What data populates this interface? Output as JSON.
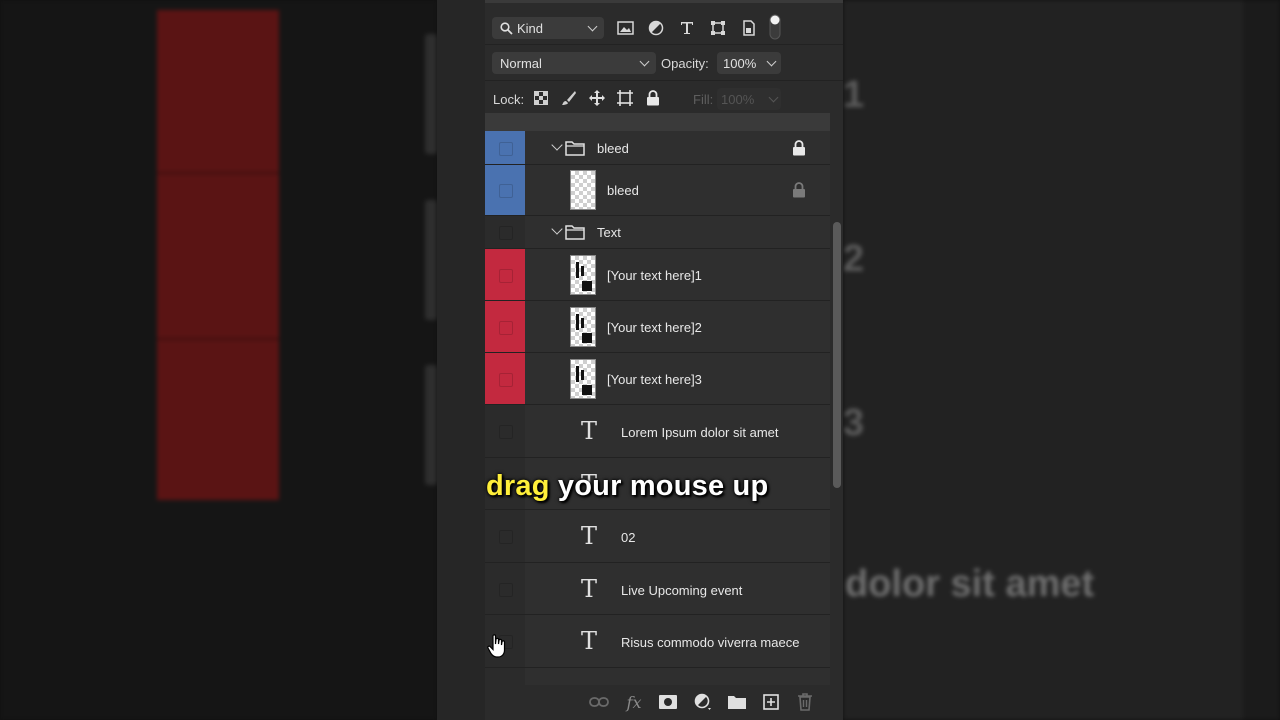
{
  "colors": {
    "panel_bg": "#2b2b2b",
    "row_bg": "#2f2f2f",
    "label_blue": "#4a72b0",
    "label_red": "#c3293f",
    "caption_highlight": "#ffef3a",
    "caption_text": "#ffffff"
  },
  "background": {
    "num1": "1",
    "num2": "2",
    "num3": "3",
    "text": "dolor sit amet"
  },
  "filter": {
    "kind_label": "Kind",
    "icons": [
      "image-filter-icon",
      "adjustment-filter-icon",
      "type-filter-icon",
      "shape-filter-icon",
      "smart-object-filter-icon",
      "filter-toggle-icon"
    ]
  },
  "blend": {
    "mode": "Normal",
    "opacity_label": "Opacity:",
    "opacity_value": "100%"
  },
  "lock": {
    "label": "Lock:",
    "icons": [
      "lock-transparent-icon",
      "lock-paint-icon",
      "lock-position-icon",
      "lock-artboard-icon",
      "lock-all-icon"
    ],
    "fill_label": "Fill:",
    "fill_value": "100%"
  },
  "layers": [
    {
      "name": "bleed",
      "kind": "group",
      "label_color": "blue",
      "locked": true,
      "expanded": true
    },
    {
      "name": "bleed",
      "kind": "pixel",
      "label_color": "blue",
      "locked": true
    },
    {
      "name": "Text",
      "kind": "group",
      "label_color": "none",
      "expanded": true
    },
    {
      "name": "[Your text here]1",
      "kind": "smart",
      "label_color": "red"
    },
    {
      "name": "[Your text here]2",
      "kind": "smart",
      "label_color": "red"
    },
    {
      "name": "[Your text here]3",
      "kind": "smart",
      "label_color": "red"
    },
    {
      "name": "Lorem Ipsum dolor sit amet",
      "kind": "type",
      "label_color": "none"
    },
    {
      "name": "",
      "kind": "type",
      "label_color": "none"
    },
    {
      "name": "02",
      "kind": "type",
      "label_color": "none"
    },
    {
      "name": "Live Upcoming event",
      "kind": "type",
      "label_color": "none"
    },
    {
      "name": "Risus commodo viverra maece",
      "kind": "type",
      "label_color": "none"
    }
  ],
  "bottom_icons": [
    "link-layers-icon",
    "fx-icon",
    "add-mask-icon",
    "new-adjustment-icon",
    "new-group-icon",
    "new-layer-icon",
    "delete-layer-icon"
  ],
  "caption": {
    "highlight": "drag",
    "rest": "your mouse up"
  }
}
